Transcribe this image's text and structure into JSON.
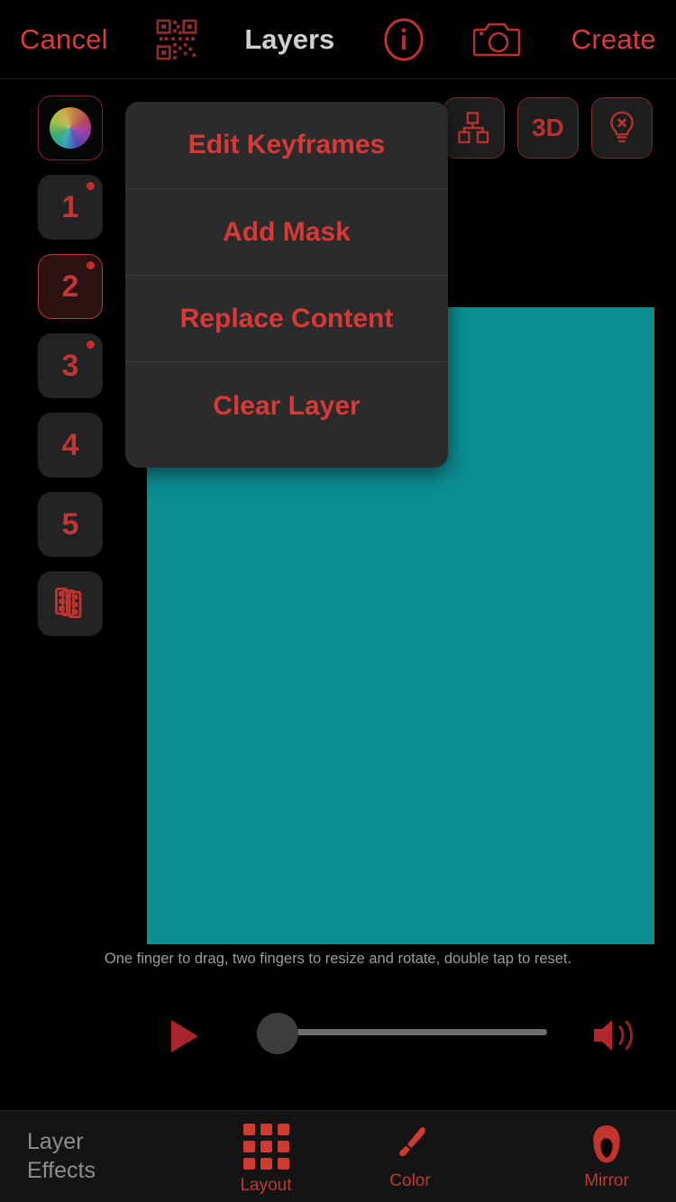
{
  "topbar": {
    "cancel_label": "Cancel",
    "qr_icon": "qr-code-icon",
    "title": "Layers",
    "info_icon": "info-icon",
    "camera_icon": "camera-icon",
    "create_label": "Create"
  },
  "sidebar": {
    "color_wheel": {
      "name": "color-wheel",
      "label": ""
    },
    "layers": [
      {
        "label": "1",
        "has_dot": true,
        "selected": false
      },
      {
        "label": "2",
        "has_dot": true,
        "selected": true
      },
      {
        "label": "3",
        "has_dot": true,
        "selected": false
      },
      {
        "label": "4",
        "has_dot": false,
        "selected": false
      },
      {
        "label": "5",
        "has_dot": false,
        "selected": false
      }
    ],
    "frames_icon": "layer-stack-icon"
  },
  "right_tools": [
    {
      "name": "hierarchy-icon",
      "label": ""
    },
    {
      "name": "3d-button",
      "label": "3D"
    },
    {
      "name": "lightbulb-off-icon",
      "label": ""
    }
  ],
  "canvas": {
    "fill_color": "#0b8d91",
    "hint": "One finger to drag, two fingers to resize and rotate, double tap to reset."
  },
  "context_menu": {
    "items": [
      {
        "label": "Edit Keyframes"
      },
      {
        "label": "Add Mask"
      },
      {
        "label": "Replace Content"
      },
      {
        "label": "Clear Layer"
      }
    ]
  },
  "playback": {
    "play_icon": "play-icon",
    "slider_value": 0,
    "slider_min": 0,
    "slider_max": 100,
    "volume_icon": "volume-icon"
  },
  "tabbar": {
    "section_label_line1": "Layer",
    "section_label_line2": "Effects",
    "tabs": [
      {
        "label": "Layout",
        "icon": "grid-icon"
      },
      {
        "label": "Color",
        "icon": "brush-icon"
      },
      {
        "label": "Mirror",
        "icon": "face-icon"
      }
    ]
  },
  "colors": {
    "accent_red": "#d93c3c",
    "dim_red": "#b8322f",
    "canvas_teal": "#0b8d91",
    "menu_bg": "#2b2b2b",
    "background": "#000000"
  }
}
